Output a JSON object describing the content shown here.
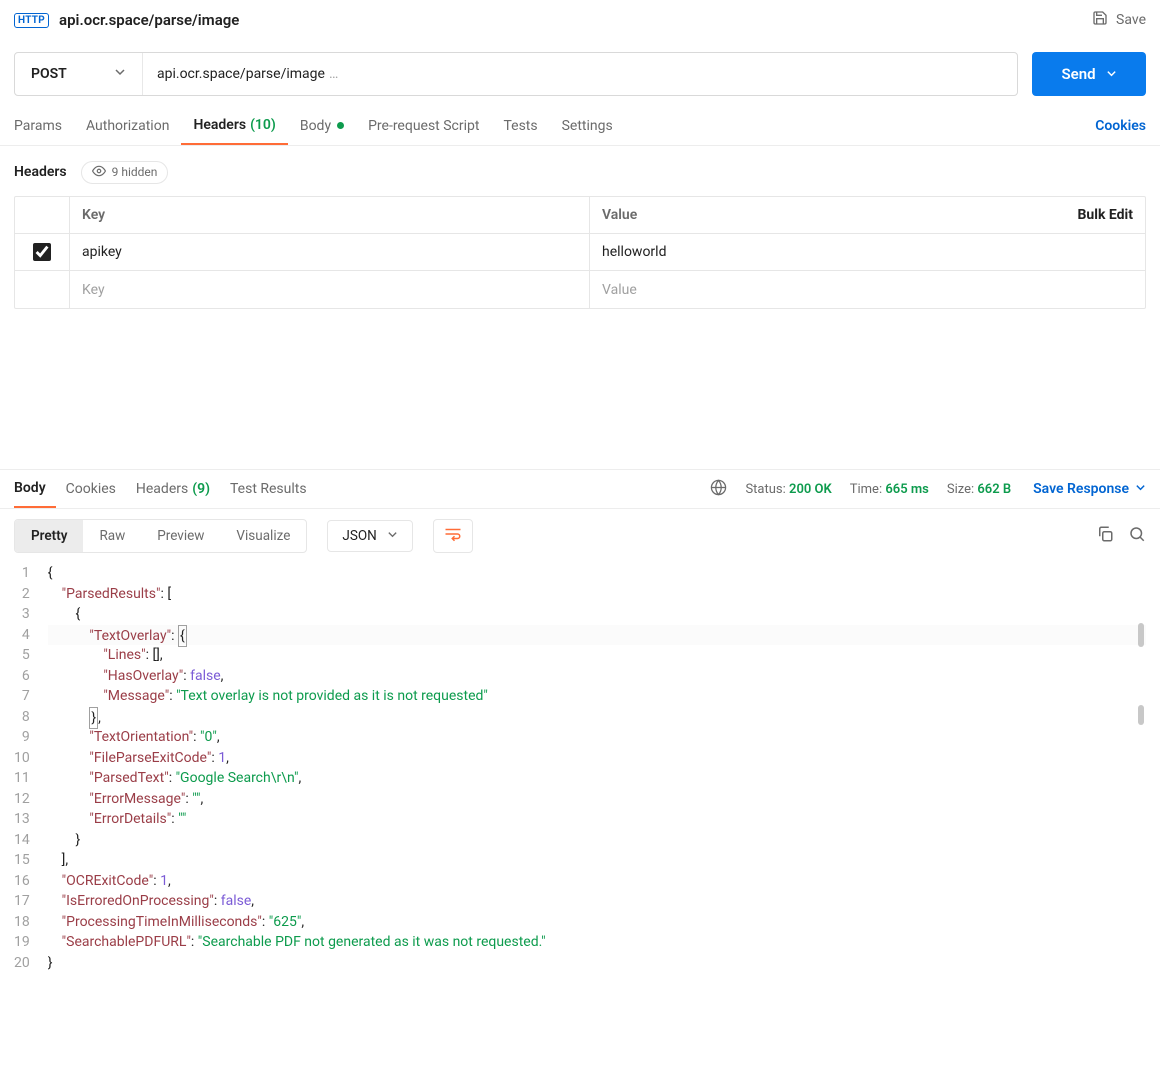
{
  "title": "api.ocr.space/parse/image",
  "save_label": "Save",
  "request": {
    "method": "POST",
    "url": "api.ocr.space/parse/image",
    "url_suffix": "…",
    "send_label": "Send"
  },
  "req_tabs": {
    "params": "Params",
    "authorization": "Authorization",
    "headers_label": "Headers",
    "headers_count": "(10)",
    "body": "Body",
    "pre_request": "Pre-request Script",
    "tests": "Tests",
    "settings": "Settings",
    "cookies_link": "Cookies"
  },
  "headers_section": {
    "title": "Headers",
    "hidden_pill": "9 hidden",
    "col_key": "Key",
    "col_value": "Value",
    "bulk_edit": "Bulk Edit",
    "rows": [
      {
        "key": "apikey",
        "value": "helloworld"
      }
    ],
    "placeholder_key": "Key",
    "placeholder_value": "Value"
  },
  "resp_tabs": {
    "body": "Body",
    "cookies": "Cookies",
    "headers_label": "Headers",
    "headers_count": "(9)",
    "test_results": "Test Results"
  },
  "status": {
    "status_label": "Status:",
    "status_value": "200 OK",
    "time_label": "Time:",
    "time_value": "665 ms",
    "size_label": "Size:",
    "size_value": "662 B",
    "save_response": "Save Response"
  },
  "resp_toolbar": {
    "pretty": "Pretty",
    "raw": "Raw",
    "preview": "Preview",
    "visualize": "Visualize",
    "language": "JSON"
  },
  "code": {
    "lines": [
      "1",
      "2",
      "3",
      "4",
      "5",
      "6",
      "7",
      "8",
      "9",
      "10",
      "11",
      "12",
      "13",
      "14",
      "15",
      "16",
      "17",
      "18",
      "19",
      "20"
    ],
    "k_ParsedResults": "\"ParsedResults\"",
    "k_TextOverlay": "\"TextOverlay\"",
    "k_Lines": "\"Lines\"",
    "k_HasOverlay": "\"HasOverlay\"",
    "k_Message": "\"Message\"",
    "v_Message": "\"Text overlay is not provided as it is not requested\"",
    "k_TextOrientation": "\"TextOrientation\"",
    "v_TextOrientation": "\"0\"",
    "k_FileParseExitCode": "\"FileParseExitCode\"",
    "v_FileParseExitCode": "1",
    "k_ParsedText": "\"ParsedText\"",
    "v_ParsedText": "\"Google Search\\r\\n\"",
    "k_ErrorMessage": "\"ErrorMessage\"",
    "k_ErrorDetails": "\"ErrorDetails\"",
    "v_emptyStr": "\"\"",
    "k_OCRExitCode": "\"OCRExitCode\"",
    "v_OCRExitCode": "1",
    "k_IsErroredOnProcessing": "\"IsErroredOnProcessing\"",
    "k_ProcessingTime": "\"ProcessingTimeInMilliseconds\"",
    "v_ProcessingTime": "\"625\"",
    "k_SearchablePDFURL": "\"SearchablePDFURL\"",
    "v_SearchablePDFURL": "\"Searchable PDF not generated as it was not requested.\"",
    "v_false": "false"
  }
}
